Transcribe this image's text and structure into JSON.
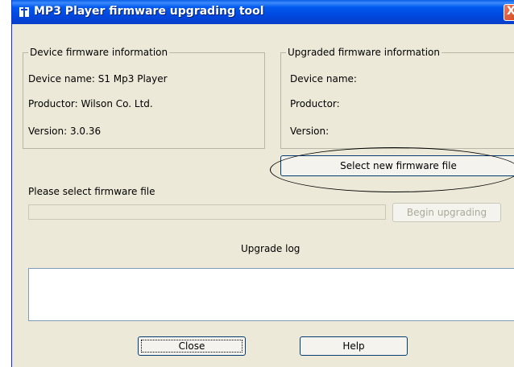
{
  "window": {
    "title": "MP3 Player firmware upgrading tool",
    "close_symbol": "X"
  },
  "device_info": {
    "legend": "Device firmware information",
    "device_name": "Device name: S1 Mp3 Player",
    "productor": "Productor: Wilson Co. Ltd.",
    "version": "Version: 3.0.36"
  },
  "upgraded_info": {
    "legend": "Upgraded firmware information",
    "device_name": "Device name:",
    "productor": "Productor:",
    "version": "Version:"
  },
  "buttons": {
    "select_file": "Select new firmware file",
    "begin_upgrading": "Begin upgrading",
    "close": "Close",
    "help": "Help"
  },
  "file_select": {
    "label": "Please select firmware file",
    "value": ""
  },
  "log": {
    "label": "Upgrade log",
    "content": ""
  }
}
